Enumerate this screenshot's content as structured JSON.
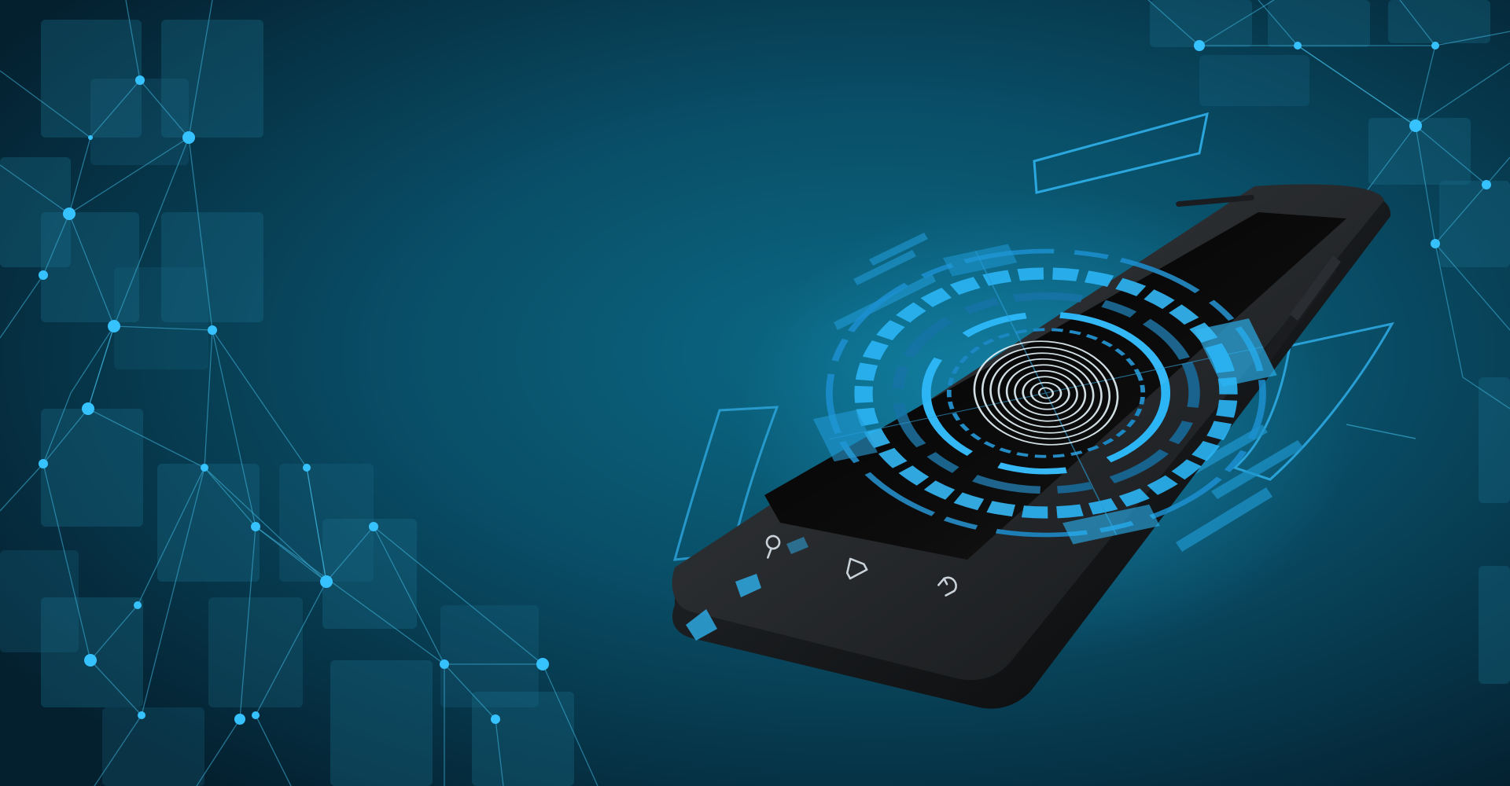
{
  "scene": {
    "colors": {
      "background_center": "#0b6a86",
      "background_edge": "#052131",
      "accent": "#2fb7f5",
      "accent_soft": "#1e8bbd",
      "phone_body": "#0c0e10",
      "screen": "#000000"
    },
    "icons": [
      "fingerprint-icon",
      "search-icon",
      "home-icon",
      "back-icon"
    ]
  }
}
